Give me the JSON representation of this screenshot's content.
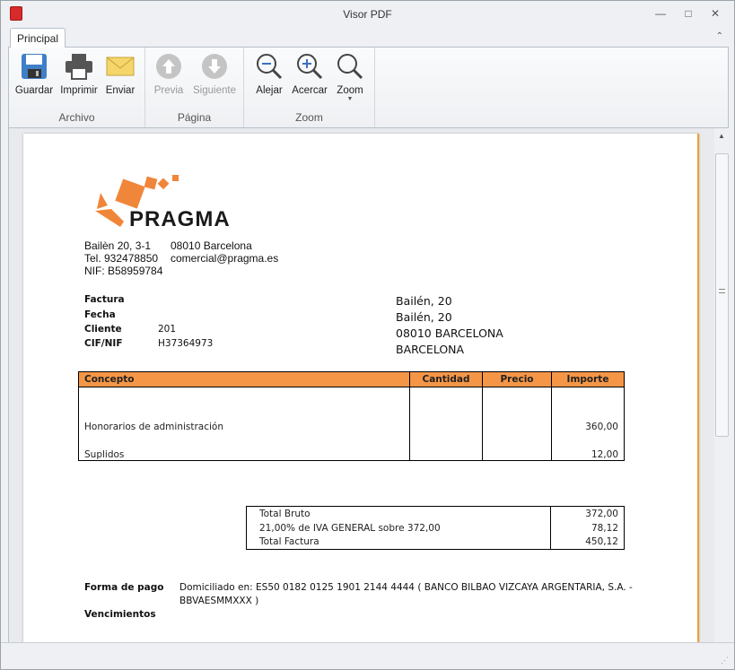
{
  "window": {
    "title": "Visor PDF"
  },
  "ribbon": {
    "tab": "Principal",
    "groups": [
      {
        "label": "Archivo",
        "buttons": [
          {
            "label": "Guardar",
            "icon": "floppy-disk-icon"
          },
          {
            "label": "Imprimir",
            "icon": "printer-icon"
          },
          {
            "label": "Enviar",
            "icon": "envelope-icon"
          }
        ]
      },
      {
        "label": "Página",
        "buttons": [
          {
            "label": "Previa",
            "icon": "arrow-up-circle-icon"
          },
          {
            "label": "Siguiente",
            "icon": "arrow-down-circle-icon"
          }
        ]
      },
      {
        "label": "Zoom",
        "buttons": [
          {
            "label": "Alejar",
            "icon": "zoom-out-icon"
          },
          {
            "label": "Acercar",
            "icon": "zoom-in-icon"
          },
          {
            "label": "Zoom",
            "icon": "magnifier-icon"
          }
        ]
      }
    ]
  },
  "invoice": {
    "logo": "PRAGMA",
    "company": {
      "address": "Bailèn 20, 3-1",
      "city": "08010 Barcelona",
      "phone": "Tel. 932478850",
      "email": "comercial@pragma.es",
      "nif": "NIF: B58959784"
    },
    "meta": [
      {
        "label": "Factura",
        "value": ""
      },
      {
        "label": "Fecha",
        "value": ""
      },
      {
        "label": "Cliente",
        "value": "201"
      },
      {
        "label": "CIF/NIF",
        "value": "H37364973"
      }
    ],
    "recipient": [
      "Bailén, 20",
      "Bailén, 20",
      "08010 BARCELONA",
      "BARCELONA"
    ],
    "columns": [
      "Concepto",
      "Cantidad",
      "Precio",
      "Importe"
    ],
    "lines": [
      {
        "concepto": "Honorarios de administración",
        "importe": "360,00"
      },
      {
        "concepto": "Suplidos",
        "importe": "12,00"
      }
    ],
    "totals": [
      {
        "label": "Total Bruto",
        "value": "372,00"
      },
      {
        "label": "21,00% de IVA GENERAL sobre 372,00",
        "value": "78,12"
      },
      {
        "label": "Total Factura",
        "value": "450,12"
      }
    ],
    "payment_label": "Forma de pago",
    "payment_line1": "Domiciliado en:  ES50 0182 0125 1901 2144 4444 ( BANCO BILBAO VIZCAYA ARGENTARIA, S.A. -",
    "payment_line2": "BBVAESMMXXX  )",
    "due_label": "Vencimientos"
  }
}
